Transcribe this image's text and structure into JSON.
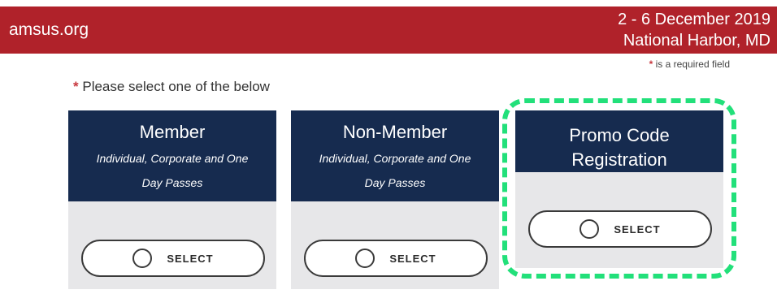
{
  "header": {
    "site_name": "amsus.org",
    "event_dates": "2 - 6 December 2019",
    "event_location": "National Harbor, MD"
  },
  "required_note": {
    "asterisk": "*",
    "text": "is a required field"
  },
  "prompt": {
    "asterisk": "*",
    "text": "Please select one of the below"
  },
  "cards": [
    {
      "title": "Member",
      "subtitle_line1": "Individual, Corporate and One",
      "subtitle_line2": "Day Passes",
      "button_label": "SELECT"
    },
    {
      "title": "Non-Member",
      "subtitle_line1": "Individual, Corporate and One",
      "subtitle_line2": "Day Passes",
      "button_label": "SELECT"
    },
    {
      "title": "Promo Code Registration",
      "button_label": "SELECT"
    }
  ],
  "colors": {
    "header_red": "#b0222a",
    "card_navy": "#162b4f",
    "card_gray": "#e7e7e9",
    "highlight_green": "#22e07a"
  }
}
